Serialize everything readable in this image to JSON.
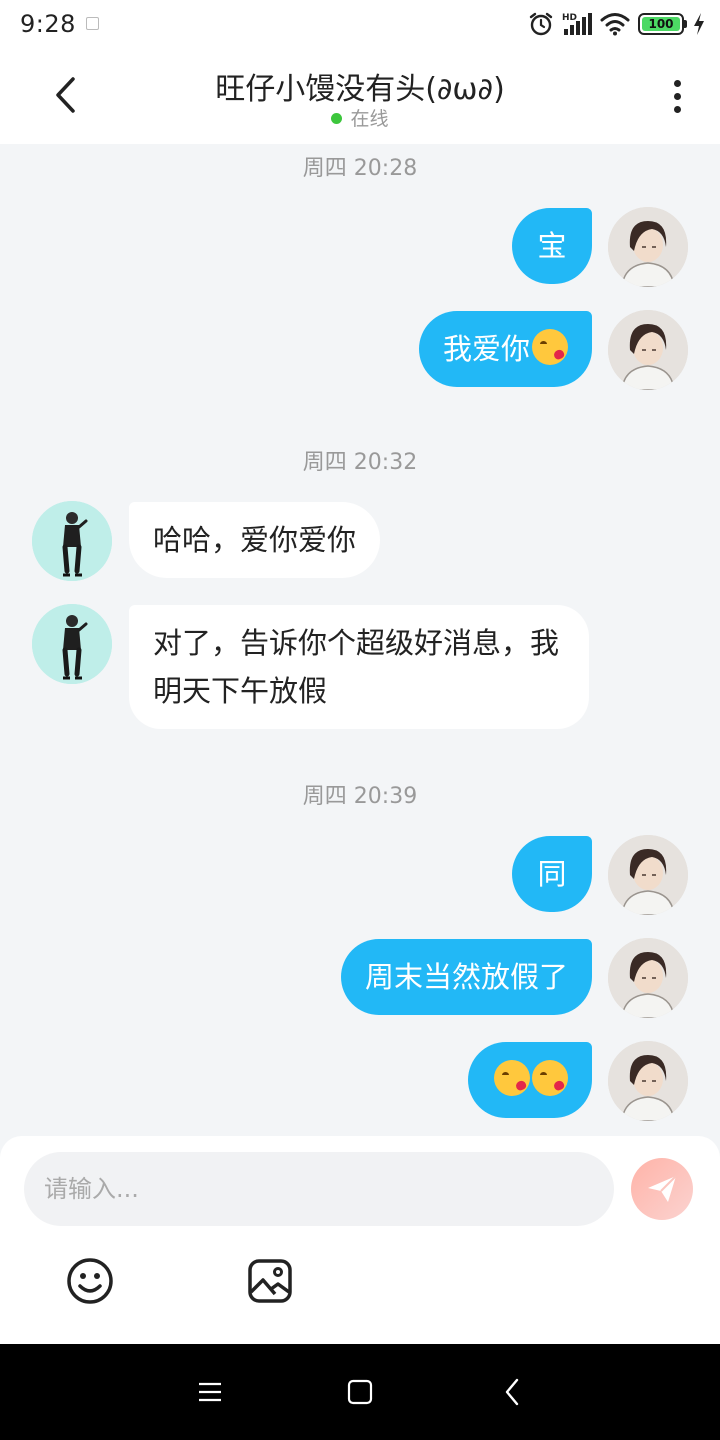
{
  "status_bar": {
    "time": "9:28",
    "battery_label": "100",
    "icons": [
      "app-notification-icon",
      "alarm-icon",
      "hd-signal-icon",
      "wifi-icon",
      "battery-icon",
      "charging-icon"
    ]
  },
  "header": {
    "title": "旺仔小馒没有头(∂ω∂)",
    "status": "在线",
    "status_color": "#3cc63c",
    "icons": [
      "back-arrow-icon",
      "more-vertical-icon"
    ]
  },
  "chat": {
    "timestamps": [
      "周四 20:28",
      "周四 20:32",
      "周四 20:39"
    ],
    "messages": [
      {
        "from": "me",
        "text": "宝"
      },
      {
        "from": "me",
        "text": "我爱你"
      },
      {
        "from": "her",
        "text": "哈哈，爱你爱你"
      },
      {
        "from": "her",
        "text": "对了，告诉你个超级好消息，我明天下午放假"
      },
      {
        "from": "me",
        "text": "同"
      },
      {
        "from": "me",
        "text": "周末当然放假了"
      },
      {
        "from": "me",
        "text": ""
      }
    ],
    "emoji_name": "face-blowing-kiss-emoji",
    "bubble_me_color": "#22b8f6",
    "bubble_her_color": "#ffffff"
  },
  "input": {
    "placeholder": "请输入...",
    "icons": [
      "send-icon",
      "smiley-icon",
      "image-icon"
    ]
  },
  "navbar": {
    "icons": [
      "menu-icon",
      "home-icon",
      "back-icon"
    ]
  }
}
